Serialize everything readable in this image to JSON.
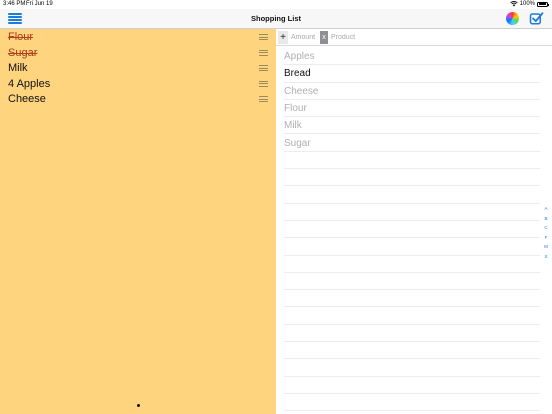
{
  "status_bar": {
    "time": "3:46 PM",
    "date": "Fri Jun 19",
    "battery": "100%",
    "battery_level": 1.0
  },
  "nav_bar": {
    "title": "Shopping List",
    "menu_icon": "hamburger-menu-icon",
    "color_icon": "color-wheel-icon",
    "check_icon": "checkbox-check-icon",
    "accent": "#1e7bd6"
  },
  "shopping_list": {
    "background": "#ffd47e",
    "items": [
      {
        "label": "Flour",
        "checked": true
      },
      {
        "label": "Sugar",
        "checked": true
      },
      {
        "label": "Milk",
        "checked": false
      },
      {
        "label": "4 Apples",
        "checked": false
      },
      {
        "label": "Cheese",
        "checked": false
      }
    ]
  },
  "entry": {
    "add_label": "+",
    "amount_placeholder": "Amount",
    "clear_label": "x",
    "product_placeholder": "Product"
  },
  "catalog": {
    "items": [
      {
        "label": "Apples",
        "in_list": false
      },
      {
        "label": "Bread",
        "in_list": true
      },
      {
        "label": "Cheese",
        "in_list": false
      },
      {
        "label": "Flour",
        "in_list": false
      },
      {
        "label": "Milk",
        "in_list": false
      },
      {
        "label": "Sugar",
        "in_list": false
      }
    ],
    "index": [
      "A",
      "B",
      "C",
      "F",
      "M",
      "S"
    ]
  }
}
